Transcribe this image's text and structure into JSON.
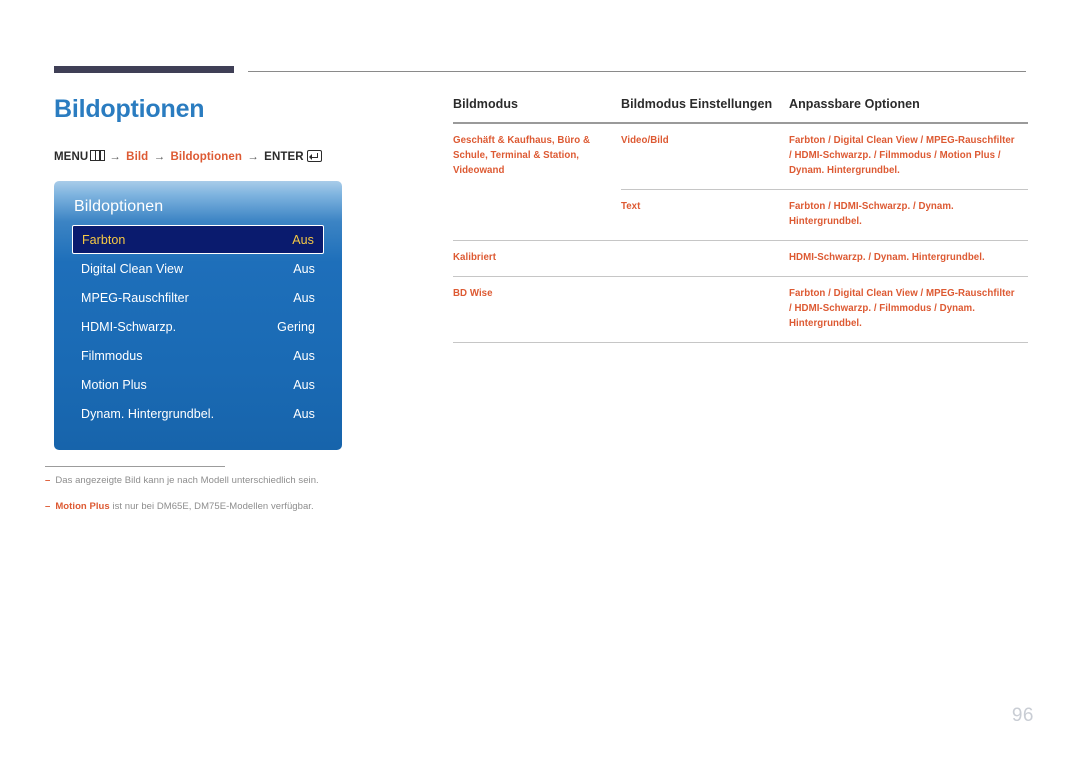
{
  "header": {
    "title": "Bildoptionen",
    "breadcrumb": {
      "menu_label": "MENU",
      "menu_icon": "menu-grid-icon",
      "arrow": "→",
      "step1": "Bild",
      "step2": "Bildoptionen",
      "enter_label": "ENTER",
      "enter_icon": "enter-key-icon"
    }
  },
  "osd": {
    "title": "Bildoptionen",
    "rows": [
      {
        "label": "Farbton",
        "value": "Aus",
        "selected": true
      },
      {
        "label": "Digital Clean View",
        "value": "Aus",
        "selected": false
      },
      {
        "label": "MPEG-Rauschfilter",
        "value": "Aus",
        "selected": false
      },
      {
        "label": "HDMI-Schwarzp.",
        "value": "Gering",
        "selected": false
      },
      {
        "label": "Filmmodus",
        "value": "Aus",
        "selected": false
      },
      {
        "label": "Motion Plus",
        "value": "Aus",
        "selected": false
      },
      {
        "label": "Dynam. Hintergrundbel.",
        "value": "Aus",
        "selected": false
      }
    ]
  },
  "footnotes": [
    {
      "dash": "–",
      "accent": "",
      "text": "Das angezeigte Bild kann je nach Modell unterschiedlich sein."
    },
    {
      "dash": "–",
      "accent": "Motion Plus",
      "text": " ist nur bei DM65E, DM75E-Modellen verfügbar."
    }
  ],
  "table": {
    "headers": [
      "Bildmodus",
      "Bildmodus Einstellungen",
      "Anpassbare Optionen"
    ],
    "rows": [
      {
        "rule": "full",
        "mode": "Geschäft & Kaufhaus, Büro & Schule, Terminal & Station, Videowand",
        "settings": "Video/Bild",
        "options": "Farbton / Digital Clean View / MPEG-Rauschfilter / HDMI-Schwarzp. / Filmmodus / Motion Plus / Dynam. Hintergrundbel."
      },
      {
        "rule": "part",
        "mode": "",
        "settings": "Text",
        "options": "Farbton / HDMI-Schwarzp. / Dynam. Hintergrundbel."
      },
      {
        "rule": "full",
        "mode": "Kalibriert",
        "settings": "",
        "options": "HDMI-Schwarzp. / Dynam. Hintergrundbel."
      },
      {
        "rule": "full",
        "mode": "BD Wise",
        "settings": "",
        "options": "Farbton / Digital Clean View / MPEG-Rauschfilter / HDMI-Schwarzp. / Filmmodus / Dynam. Hintergrundbel."
      }
    ]
  },
  "page_number": "96",
  "colors": {
    "title_blue": "#2a7cc0",
    "accent_orange": "#dd5a33",
    "osd_blue": "#1e6fba",
    "osd_selected_bg": "#0a1b6e",
    "osd_selected_text": "#f6c944",
    "rule_dark": "#3f3f56",
    "page_number": "#c9cdd4"
  }
}
